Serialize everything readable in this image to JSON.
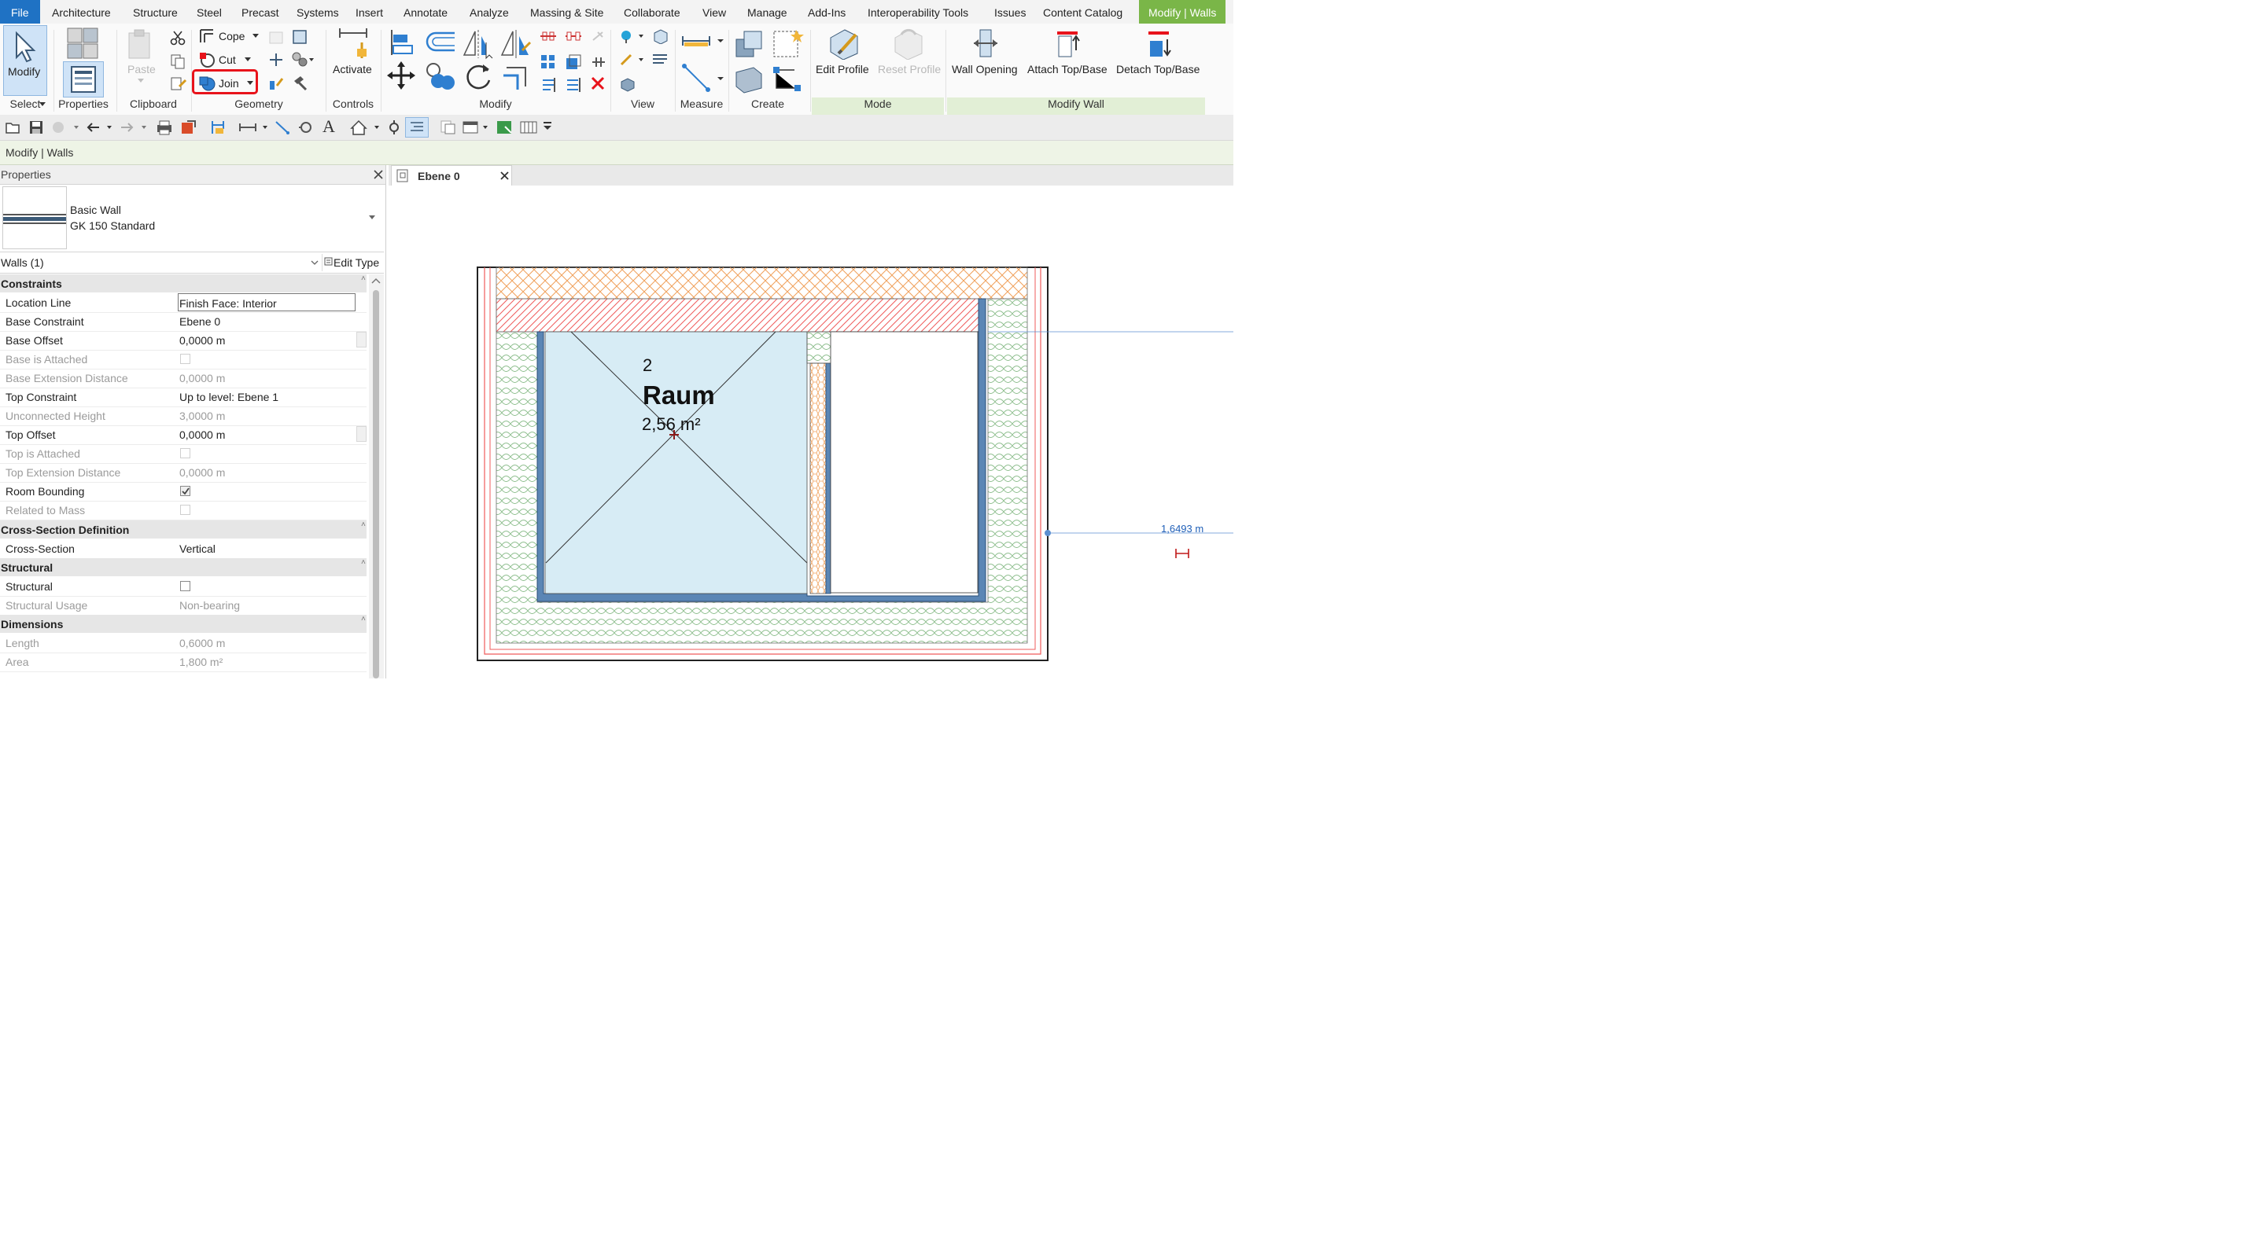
{
  "menu": {
    "tabs": [
      "File",
      "Architecture",
      "Structure",
      "Steel",
      "Precast",
      "Systems",
      "Insert",
      "Annotate",
      "Analyze",
      "Massing & Site",
      "Collaborate",
      "View",
      "Manage",
      "Add-Ins",
      "Interoperability Tools",
      "Issues",
      "Content Catalog",
      "Modify | Walls"
    ]
  },
  "ribbon": {
    "select": {
      "modify_label": "Modify",
      "panel": "Select"
    },
    "properties": {
      "label": "Properties"
    },
    "clipboard": {
      "paste_label": "Paste",
      "panel": "Clipboard"
    },
    "geometry": {
      "cope": "Cope",
      "cut": "Cut",
      "join": "Join",
      "panel": "Geometry"
    },
    "controls": {
      "activate": "Activate",
      "panel": "Controls"
    },
    "modify": {
      "panel": "Modify"
    },
    "view": {
      "panel": "View"
    },
    "measure": {
      "panel": "Measure"
    },
    "create": {
      "panel": "Create"
    },
    "mode": {
      "edit_profile": "Edit Profile",
      "reset_profile": "Reset Profile",
      "panel": "Mode"
    },
    "modify_wall": {
      "wall_opening": "Wall Opening",
      "attach": "Attach Top/Base",
      "detach": "Detach Top/Base",
      "panel": "Modify Wall"
    }
  },
  "options_bar": {
    "text": "Modify | Walls"
  },
  "properties": {
    "title": "Properties",
    "type_family": "Basic Wall",
    "type_name": "GK 150 Standard",
    "selector": "Walls (1)",
    "edit_type": "Edit Type",
    "categories": {
      "constraints": "Constraints",
      "cross_section": "Cross-Section Definition",
      "structural": "Structural",
      "dimensions": "Dimensions"
    },
    "rows": {
      "location_line": {
        "k": "Location Line",
        "v": "Finish Face: Interior"
      },
      "base_constraint": {
        "k": "Base Constraint",
        "v": "Ebene 0"
      },
      "base_offset": {
        "k": "Base Offset",
        "v": "0,0000 m"
      },
      "base_attached": {
        "k": "Base is Attached",
        "checked": false
      },
      "base_ext": {
        "k": "Base Extension Distance",
        "v": "0,0000 m"
      },
      "top_constraint": {
        "k": "Top Constraint",
        "v": "Up to level: Ebene 1"
      },
      "unconnected": {
        "k": "Unconnected Height",
        "v": "3,0000 m"
      },
      "top_offset": {
        "k": "Top Offset",
        "v": "0,0000 m"
      },
      "top_attached": {
        "k": "Top is Attached",
        "checked": false
      },
      "top_ext": {
        "k": "Top Extension Distance",
        "v": "0,0000 m"
      },
      "room_bounding": {
        "k": "Room Bounding",
        "checked": true
      },
      "related_mass": {
        "k": "Related to Mass",
        "checked": false
      },
      "cross_section": {
        "k": "Cross-Section",
        "v": "Vertical"
      },
      "structural": {
        "k": "Structural",
        "checked": false
      },
      "structural_usage": {
        "k": "Structural Usage",
        "v": "Non-bearing"
      },
      "length": {
        "k": "Length",
        "v": "0,6000 m"
      },
      "area": {
        "k": "Area",
        "v": "1,800 m²"
      }
    }
  },
  "view": {
    "tab_title": "Ebene 0",
    "room_number": "2",
    "room_name": "Raum",
    "room_area": "2,56 m²",
    "dimension": "1,6493 m"
  },
  "colors": {
    "accent_blue": "#1f72c4",
    "context_green": "#7ab648",
    "highlight_red": "#e8131b",
    "room_fill": "#d7ecf5"
  }
}
